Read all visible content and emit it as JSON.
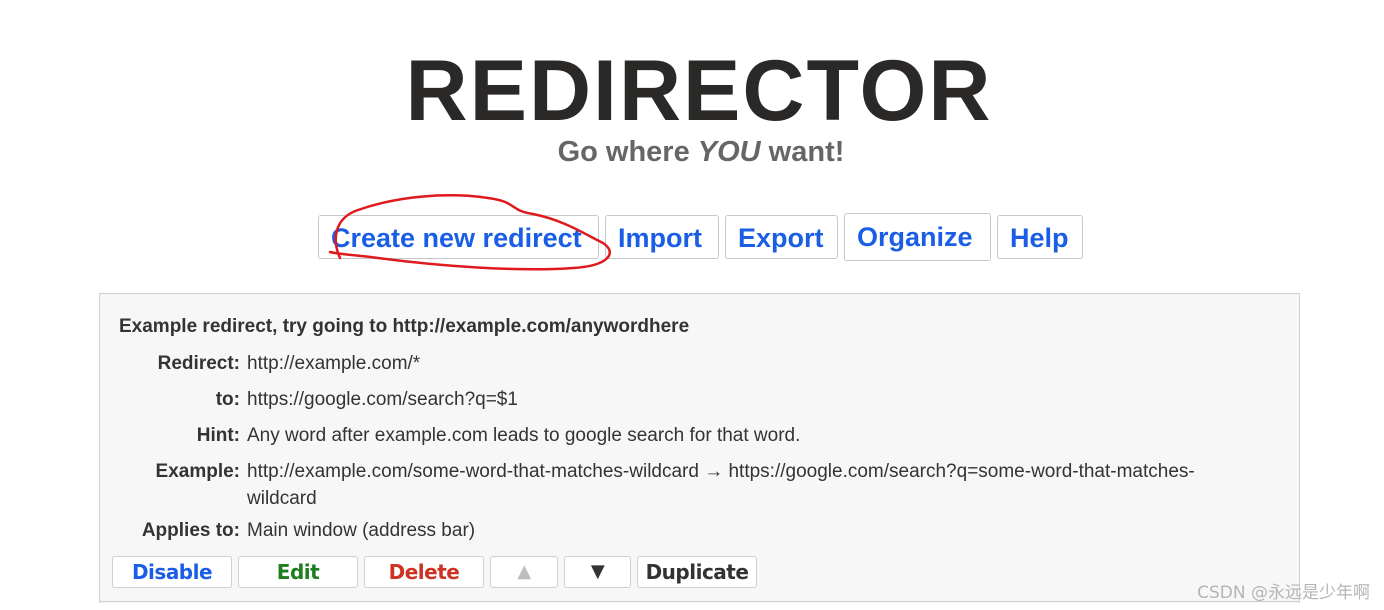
{
  "header": {
    "logo": "REDIRECTOR",
    "tagline_before": "Go where ",
    "tagline_emphasis": "YOU",
    "tagline_after": " want!"
  },
  "menu": {
    "items": [
      {
        "label": "Create new redirect",
        "id": "create"
      },
      {
        "label": "Import",
        "id": "import"
      },
      {
        "label": "Export",
        "id": "export"
      },
      {
        "label": "Organize",
        "id": "organize"
      },
      {
        "label": "Help",
        "id": "help"
      }
    ],
    "link_color": "#1a5ee6",
    "annotation_color": "#e0191c"
  },
  "redirect": {
    "title": "Example redirect, try going to http://example.com/anywordhere",
    "fields": [
      {
        "label": "Redirect:",
        "value": "http://example.com/*"
      },
      {
        "label": "to:",
        "value": "https://google.com/search?q=$1"
      },
      {
        "label": "Hint:",
        "value": "Any word after example.com leads to google search for that word."
      },
      {
        "label": "Example:",
        "value": "http://example.com/some-word-that-matches-wildcard → https://google.com/search?q=some-word-that-matches-wildcard"
      },
      {
        "label": "Applies to:",
        "value": "Main window (address bar)"
      }
    ],
    "actions": {
      "disable": "Disable",
      "edit": "Edit",
      "delete": "Delete",
      "move_up": "▲",
      "move_down": "▼",
      "duplicate": "Duplicate"
    }
  },
  "watermark": "CSDN @永远是少年啊"
}
